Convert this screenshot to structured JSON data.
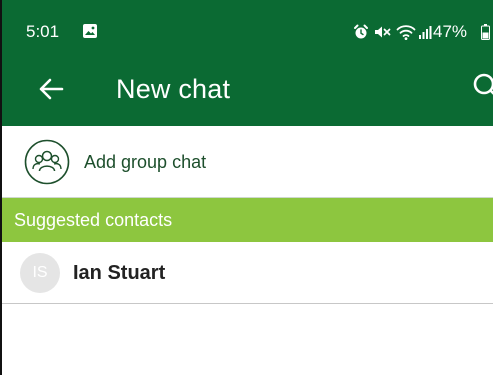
{
  "status_bar": {
    "time": "5:01",
    "battery": "47%",
    "icons": [
      "photo-icon",
      "alarm-icon",
      "mute-icon",
      "wifi-icon",
      "signal-icon",
      "battery-icon"
    ]
  },
  "app_bar": {
    "title": "New chat",
    "back_icon": "arrow-left-icon",
    "search_icon": "search-icon"
  },
  "add_group": {
    "label": "Add group chat",
    "icon": "group-icon"
  },
  "suggested": {
    "header": "Suggested contacts",
    "contacts": [
      {
        "initials": "IS",
        "name": "Ian Stuart"
      }
    ]
  },
  "colors": {
    "primary": "#0b6a33",
    "section_header": "#8dc63f",
    "avatar_bg": "#e5e5e5"
  }
}
